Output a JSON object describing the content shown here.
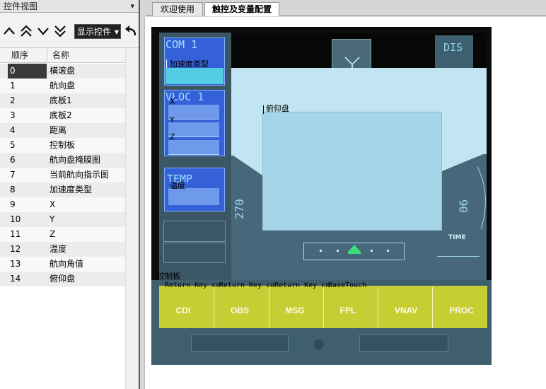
{
  "panel": {
    "title": "控件视图",
    "pin": "📌",
    "show_controls_label": "显示控件",
    "columns": {
      "index": "顺序",
      "name": "名称"
    },
    "items": [
      {
        "index": "0",
        "name": "横滚盘",
        "selected": true
      },
      {
        "index": "1",
        "name": "航向盘"
      },
      {
        "index": "2",
        "name": "底板1"
      },
      {
        "index": "3",
        "name": "底板2"
      },
      {
        "index": "4",
        "name": "距离"
      },
      {
        "index": "5",
        "name": "控制板"
      },
      {
        "index": "6",
        "name": "航向盘掩膜图"
      },
      {
        "index": "7",
        "name": "当前航向指示图"
      },
      {
        "index": "8",
        "name": "加速度类型"
      },
      {
        "index": "9",
        "name": "X"
      },
      {
        "index": "10",
        "name": "Y"
      },
      {
        "index": "11",
        "name": "Z"
      },
      {
        "index": "12",
        "name": "温度"
      },
      {
        "index": "13",
        "name": "航向角值"
      },
      {
        "index": "14",
        "name": "俯仰盘"
      }
    ]
  },
  "tabs": {
    "welcome": "欢迎使用",
    "config": "触控及变量配置"
  },
  "device": {
    "com_label": "COM 1",
    "vloc_label": "VLOC 1",
    "temp_label": "TEMP",
    "dis_label": "DIS",
    "heading_left": "270",
    "heading_right": "06",
    "time_label": "TIME",
    "soft_buttons": [
      "CDI",
      "OBS",
      "MSG",
      "FPL",
      "VNAV",
      "PROC"
    ]
  },
  "overlays": {
    "accel_type": "加速度类型",
    "x": "X",
    "y": "Y",
    "z": "Z",
    "temperature": "温度",
    "pitch_disc": "俯仰盘",
    "control_board": "控制板",
    "return_key_1": "Return Key co",
    "return_key_2": "Return Key co",
    "return_key_3": "Return Key co",
    "base_touch": "BaseTouch"
  },
  "colors": {
    "accent_blue": "#3461d8",
    "accent_cyan": "#53cde2",
    "softkey_yellow": "#c6ce34",
    "sky": "#c1e5f2"
  }
}
